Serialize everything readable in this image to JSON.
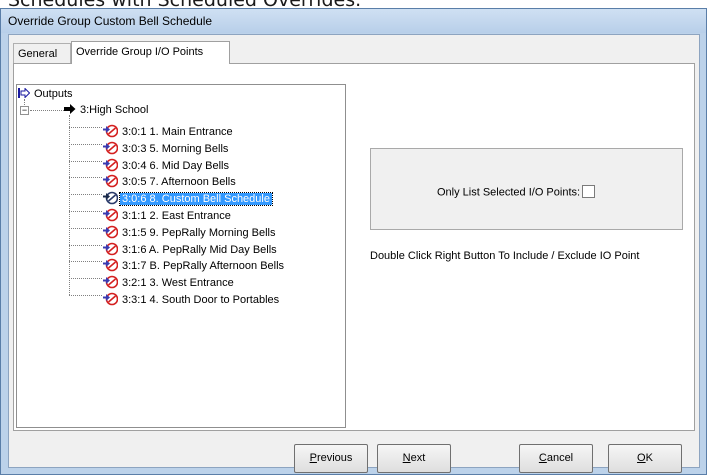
{
  "background_text": "Schedules with Scheduled Overrides.",
  "window": {
    "title": "Override Group Custom Bell Schedule"
  },
  "tabs": [
    {
      "label": "General"
    },
    {
      "label": "Override Group I/O Points"
    }
  ],
  "tree": {
    "root": "Outputs",
    "group": "3:High School",
    "items": [
      {
        "label": "3:0:1  1. Main Entrance"
      },
      {
        "label": "3:0:3  5. Morning Bells"
      },
      {
        "label": "3:0:4  6. Mid Day Bells"
      },
      {
        "label": "3:0:5  7. Afternoon Bells"
      },
      {
        "label": "3:0:6  8. Custom Bell Schedule",
        "selected": true
      },
      {
        "label": "3:1:1  2. East Entrance"
      },
      {
        "label": "3:1:5  9. PepRally Morning Bells"
      },
      {
        "label": "3:1:6  A. PepRally Mid Day Bells"
      },
      {
        "label": "3:1:7  B. PepRally Afternoon Bells"
      },
      {
        "label": "3:2:1  3. West Entrance"
      },
      {
        "label": "3:3:1  4. South Door to Portables"
      }
    ]
  },
  "options": {
    "only_list_label": "Only List Selected I/O Points:",
    "only_list_checked": false
  },
  "hint": "Double Click Right Button To Include / Exclude IO Point",
  "buttons": {
    "previous": {
      "mnemonic": "P",
      "rest": "revious"
    },
    "next": {
      "mnemonic": "N",
      "rest": "ext"
    },
    "cancel": {
      "mnemonic": "C",
      "rest": "ancel"
    },
    "ok": {
      "mnemonic": "O",
      "rest": "K"
    }
  },
  "colors": {
    "selection": "#3399ff",
    "titlebar": "#bcd2ea",
    "bell_red": "#d42020",
    "bell_blue": "#3a3ab0"
  },
  "icons": {
    "root": "arrow-outline-icon",
    "group": "arrow-icon",
    "item": "bell-output-icon"
  }
}
